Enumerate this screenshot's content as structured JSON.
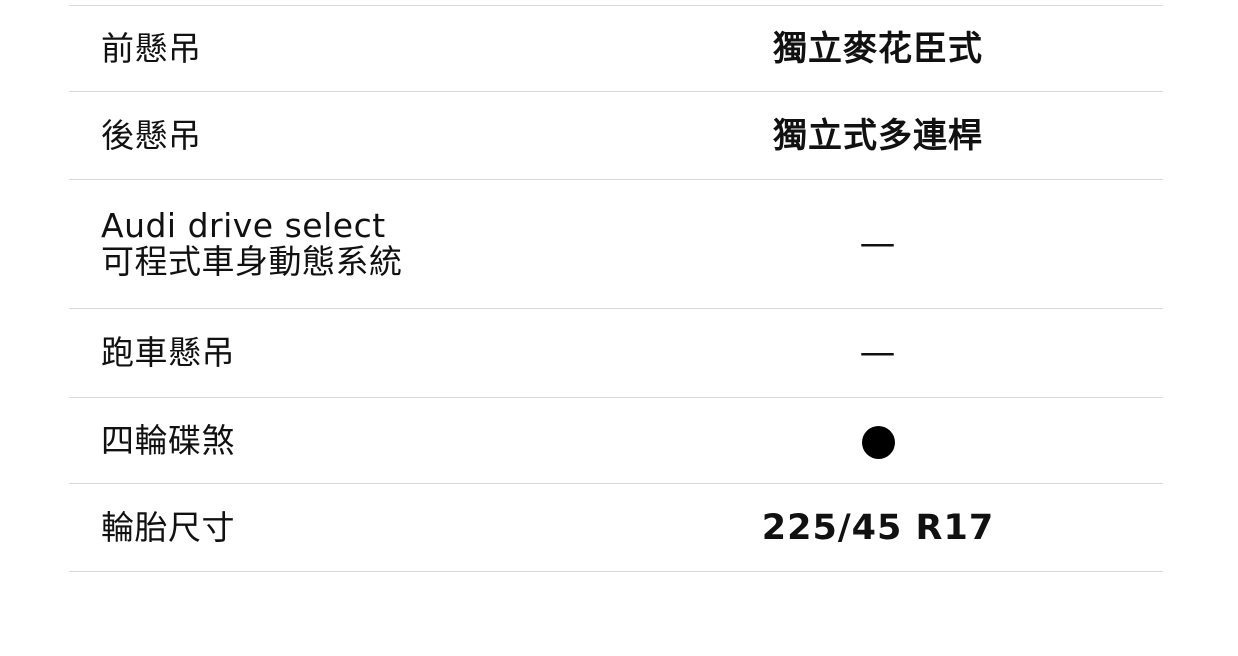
{
  "spec_rows": [
    {
      "label": "前懸吊",
      "value": "獨立麥花臣式"
    },
    {
      "label": "後懸吊",
      "value": "獨立式多連桿"
    },
    {
      "label": "Audi drive select\n可程式車身動態系統",
      "value": "—"
    },
    {
      "label": "跑車懸吊",
      "value": "—"
    },
    {
      "label": "四輪碟煞",
      "value": "●",
      "icon": "filled-circle-icon"
    },
    {
      "label": "輪胎尺寸",
      "value": "225/45 R17"
    }
  ]
}
